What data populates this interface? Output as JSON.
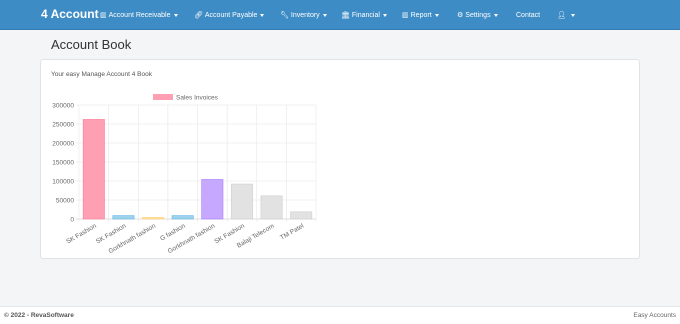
{
  "navbar": {
    "brand": "4 Account",
    "items": [
      {
        "label": "Account Receivable",
        "icon": "chart-icon",
        "dropdown": true
      },
      {
        "label": "Account Payable",
        "icon": "link-icon",
        "dropdown": true
      },
      {
        "label": "Inventory",
        "icon": "wrench-icon",
        "dropdown": true
      },
      {
        "label": "Financial",
        "icon": "bank-icon",
        "dropdown": true
      },
      {
        "label": "Report",
        "icon": "chart-icon",
        "dropdown": true
      },
      {
        "label": "Settings",
        "icon": "gear-icon",
        "dropdown": true
      },
      {
        "label": "Contact",
        "icon": "",
        "dropdown": false
      },
      {
        "label": "",
        "icon": "user-icon",
        "dropdown": true
      }
    ]
  },
  "page": {
    "title": "Account Book",
    "subtitle": "Your easy Manage Account 4 Book"
  },
  "chart_data": {
    "type": "bar",
    "categories": [
      "SK Fashion",
      "SK Fashion",
      "Gorkhnath fashion",
      "G fashion",
      "Gorkhnath fashion",
      "SK Fashion",
      "Balaji Telecom",
      "TM Patel"
    ],
    "series": [
      {
        "name": "Sales Invoices",
        "values": [
          262000,
          9000,
          4000,
          9000,
          104000,
          92000,
          61000,
          19000
        ]
      }
    ],
    "bar_colors": [
      "#ff9fb3",
      "#9fd1ec",
      "#ffe0a0",
      "#9fd1ec",
      "#c7a8ff",
      "#e2e2e2",
      "#e2e2e2",
      "#e2e2e2"
    ],
    "bar_borders": [
      "#ff7a97",
      "#62b8e6",
      "#ffcf73",
      "#62b8e6",
      "#a57cff",
      "#cfcfcf",
      "#cfcfcf",
      "#cfcfcf"
    ],
    "legend_color": "#ff9fb3",
    "yticks": [
      "300000",
      "250000",
      "200000",
      "150000",
      "100000",
      "50000",
      "0"
    ],
    "ylim": [
      0,
      300000
    ],
    "legend_position": "top",
    "grid": true
  },
  "footer": {
    "left": "© 2022 - RevaSoftware",
    "right": "Easy Accounts"
  }
}
